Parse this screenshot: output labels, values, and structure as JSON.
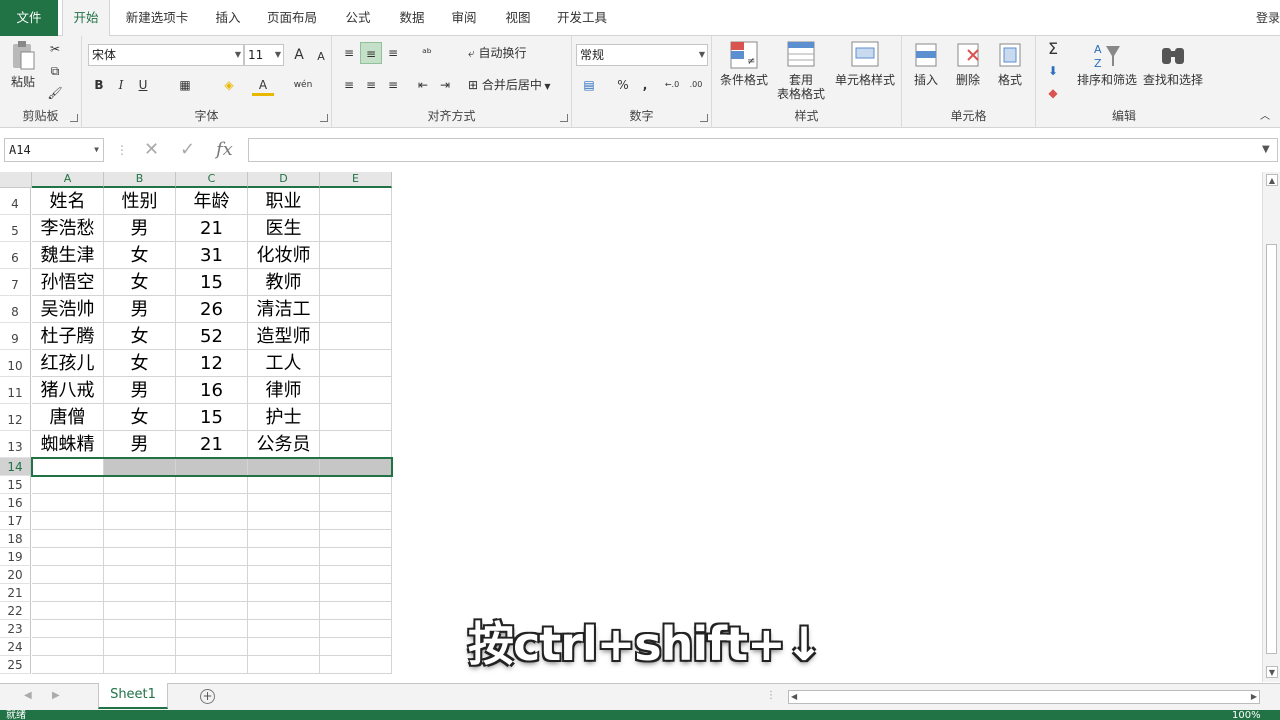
{
  "tabs": {
    "file": "文件",
    "items": [
      "开始",
      "新建选项卡",
      "插入",
      "页面布局",
      "公式",
      "数据",
      "审阅",
      "视图",
      "开发工具"
    ],
    "active_index": 0,
    "login": "登录"
  },
  "ribbon": {
    "clipboard": {
      "label": "剪贴板",
      "paste": "粘贴"
    },
    "font": {
      "label": "字体",
      "name": "宋体",
      "size": "11",
      "bold": "B",
      "italic": "I",
      "underline": "U",
      "grow": "A",
      "shrink": "A",
      "pinyin": "wén"
    },
    "alignment": {
      "label": "对齐方式",
      "wrap": "自动换行",
      "merge": "合并后居中"
    },
    "number": {
      "label": "数字",
      "format": "常规",
      "percent": "%",
      "comma": ",",
      "inc_decimal": "←.0",
      "dec_decimal": ".00"
    },
    "styles": {
      "label": "样式",
      "conditional": "条件格式",
      "table_fmt_1": "套用",
      "table_fmt_2": "表格格式",
      "cell_styles": "单元格样式"
    },
    "cells": {
      "label": "单元格",
      "insert": "插入",
      "delete": "删除",
      "format": "格式"
    },
    "editing": {
      "label": "编辑",
      "sum": "Σ",
      "sort": "排序和筛选",
      "find": "查找和选择"
    }
  },
  "formula_bar": {
    "name_box": "A14",
    "fx": "fx",
    "cancel": "✕",
    "enter": "✓",
    "formula": ""
  },
  "columns": [
    "A",
    "B",
    "C",
    "D",
    "E"
  ],
  "rows": [
    {
      "num": "4",
      "cells": [
        "姓名",
        "性别",
        "年龄",
        "职业",
        ""
      ]
    },
    {
      "num": "5",
      "cells": [
        "李浩愁",
        "男",
        "21",
        "医生",
        ""
      ]
    },
    {
      "num": "6",
      "cells": [
        "魏生津",
        "女",
        "31",
        "化妆师",
        ""
      ]
    },
    {
      "num": "7",
      "cells": [
        "孙悟空",
        "女",
        "15",
        "教师",
        ""
      ]
    },
    {
      "num": "8",
      "cells": [
        "吴浩帅",
        "男",
        "26",
        "清洁工",
        ""
      ]
    },
    {
      "num": "9",
      "cells": [
        "杜子腾",
        "女",
        "52",
        "造型师",
        ""
      ]
    },
    {
      "num": "10",
      "cells": [
        "红孩儿",
        "女",
        "12",
        "工人",
        ""
      ]
    },
    {
      "num": "11",
      "cells": [
        "猪八戒",
        "男",
        "16",
        "律师",
        ""
      ]
    },
    {
      "num": "12",
      "cells": [
        "唐僧",
        "女",
        "15",
        "护士",
        ""
      ]
    },
    {
      "num": "13",
      "cells": [
        "蜘蛛精",
        "男",
        "21",
        "公务员",
        ""
      ]
    },
    {
      "num": "14",
      "cells": [
        "",
        "",
        "",
        "",
        ""
      ]
    },
    {
      "num": "15",
      "cells": [
        "",
        "",
        "",
        "",
        ""
      ]
    },
    {
      "num": "16",
      "cells": [
        "",
        "",
        "",
        "",
        ""
      ]
    },
    {
      "num": "17",
      "cells": [
        "",
        "",
        "",
        "",
        ""
      ]
    },
    {
      "num": "18",
      "cells": [
        "",
        "",
        "",
        "",
        ""
      ]
    },
    {
      "num": "19",
      "cells": [
        "",
        "",
        "",
        "",
        ""
      ]
    },
    {
      "num": "20",
      "cells": [
        "",
        "",
        "",
        "",
        ""
      ]
    },
    {
      "num": "21",
      "cells": [
        "",
        "",
        "",
        "",
        ""
      ]
    },
    {
      "num": "22",
      "cells": [
        "",
        "",
        "",
        "",
        ""
      ]
    },
    {
      "num": "23",
      "cells": [
        "",
        "",
        "",
        "",
        ""
      ]
    },
    {
      "num": "24",
      "cells": [
        "",
        "",
        "",
        "",
        ""
      ]
    },
    {
      "num": "25",
      "cells": [
        "",
        "",
        "",
        "",
        ""
      ]
    }
  ],
  "selected_row": "14",
  "sheet": {
    "name": "Sheet1"
  },
  "status": {
    "mode": "就绪",
    "zoom": "100%"
  },
  "caption": "按ctrl+shift+↓",
  "colors": {
    "accent": "#217346"
  }
}
